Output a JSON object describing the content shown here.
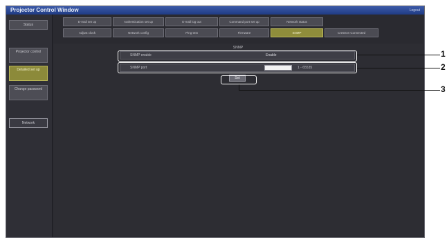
{
  "window": {
    "title": "Projector Control Window",
    "title_right": "Logout"
  },
  "sidebar": {
    "items": [
      {
        "label": "Status"
      },
      {
        "label": "Projector control"
      },
      {
        "label": "Detailed set up"
      },
      {
        "label": "Change password"
      },
      {
        "label": "Network"
      }
    ]
  },
  "tabs": {
    "row1": [
      {
        "label": "E-mail set up"
      },
      {
        "label": "Authentication set up"
      },
      {
        "label": "E-mail log out"
      },
      {
        "label": "Command port set up"
      },
      {
        "label": "Network status"
      }
    ],
    "row2": [
      {
        "label": "Adjust clock"
      },
      {
        "label": "Network config"
      },
      {
        "label": "Ping test"
      },
      {
        "label": "Firmware"
      },
      {
        "label": "SNMP"
      },
      {
        "label": "Crestron Connected"
      }
    ]
  },
  "content": {
    "heading": "SNMP",
    "rows": [
      {
        "label": "SNMP enable",
        "value": "Enable"
      },
      {
        "label": "SNMP port",
        "input_value": "",
        "hint": "1 - 65535"
      }
    ],
    "set_label": "Set"
  },
  "callouts": {
    "labels": [
      "1",
      "2",
      "3"
    ]
  }
}
